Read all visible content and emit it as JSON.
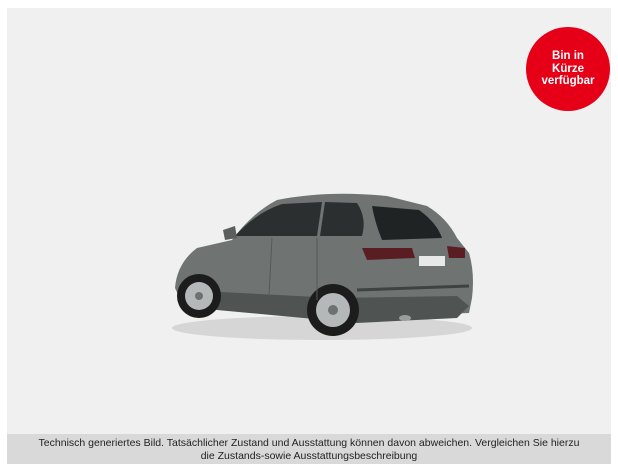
{
  "badge": {
    "lines": [
      "Bin in",
      "Kürze",
      "verfügbar"
    ],
    "color": "#e60017"
  },
  "car_image": {
    "icon": "car-rear-three-quarter-image",
    "body_color": "#6f7473"
  },
  "disclaimer": {
    "line1": "Technisch generiertes Bild. Tatsächlicher Zustand und Ausstattung können davon abweichen. Vergleichen Sie hierzu",
    "line2": "die Zustands-sowie Ausstattungsbeschreibung"
  }
}
